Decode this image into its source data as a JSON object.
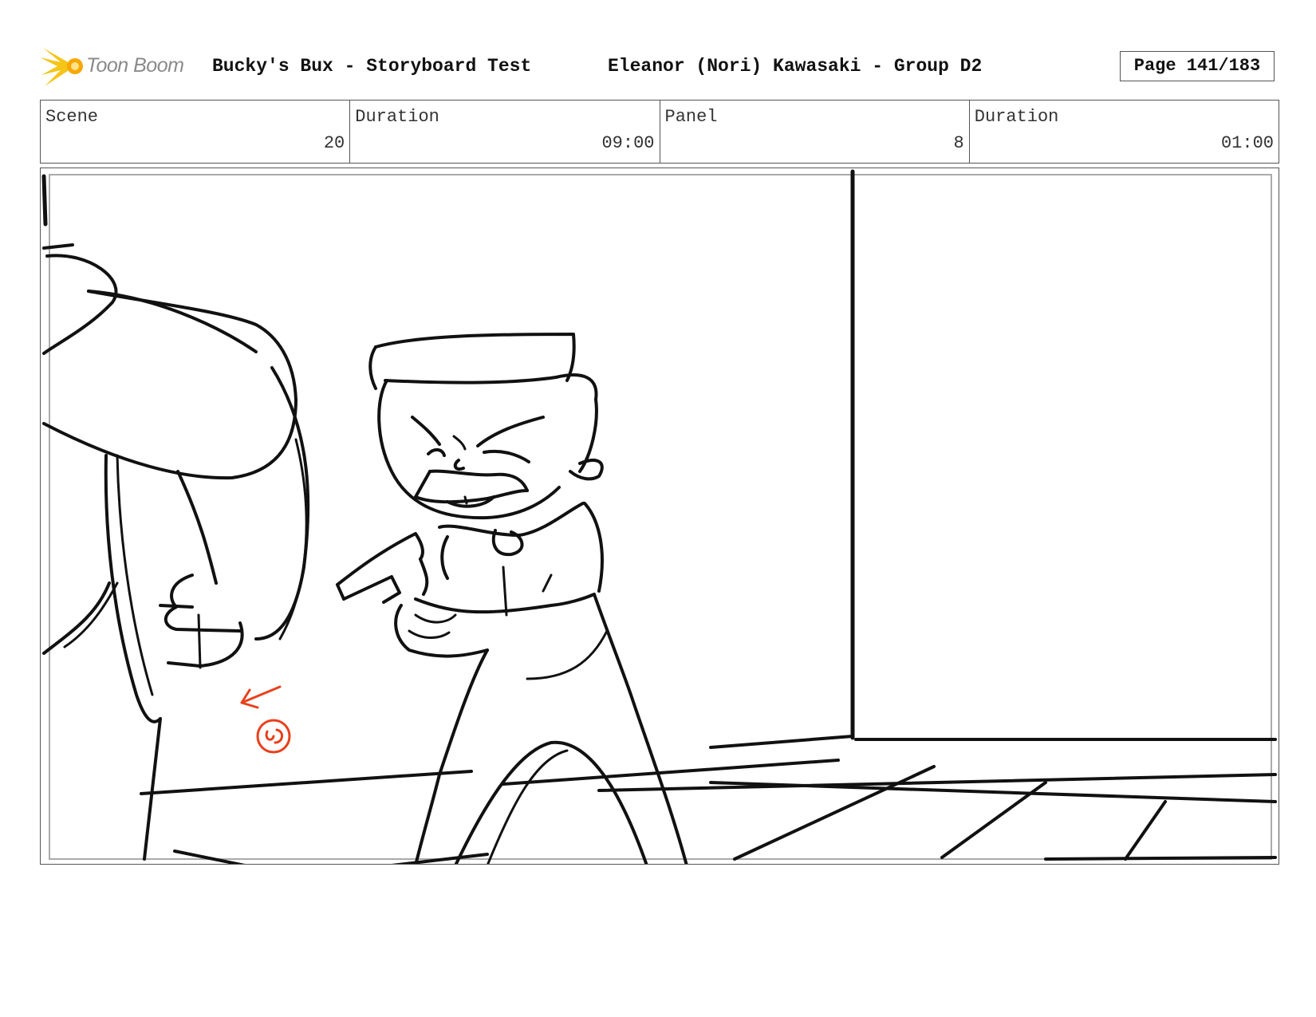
{
  "header": {
    "logo_text": "Toon Boom",
    "project_title": "Bucky's Bux - Storyboard Test",
    "artist_info": "Eleanor (Nori) Kawasaki - Group D2",
    "page_label": "Page 141/183"
  },
  "info": {
    "scene_label": "Scene",
    "scene_value": "20",
    "scene_duration_label": "Duration",
    "scene_duration_value": "09:00",
    "panel_label": "Panel",
    "panel_value": "8",
    "panel_duration_label": "Duration",
    "panel_duration_value": "01:00"
  },
  "colors": {
    "logo_accent": "#f5c518",
    "sketch_line": "#111111",
    "annotation": "#e8401c"
  },
  "icons": {
    "logo": "toon-boom-burst-icon",
    "annotation_arrow": "left-arrow-icon"
  }
}
